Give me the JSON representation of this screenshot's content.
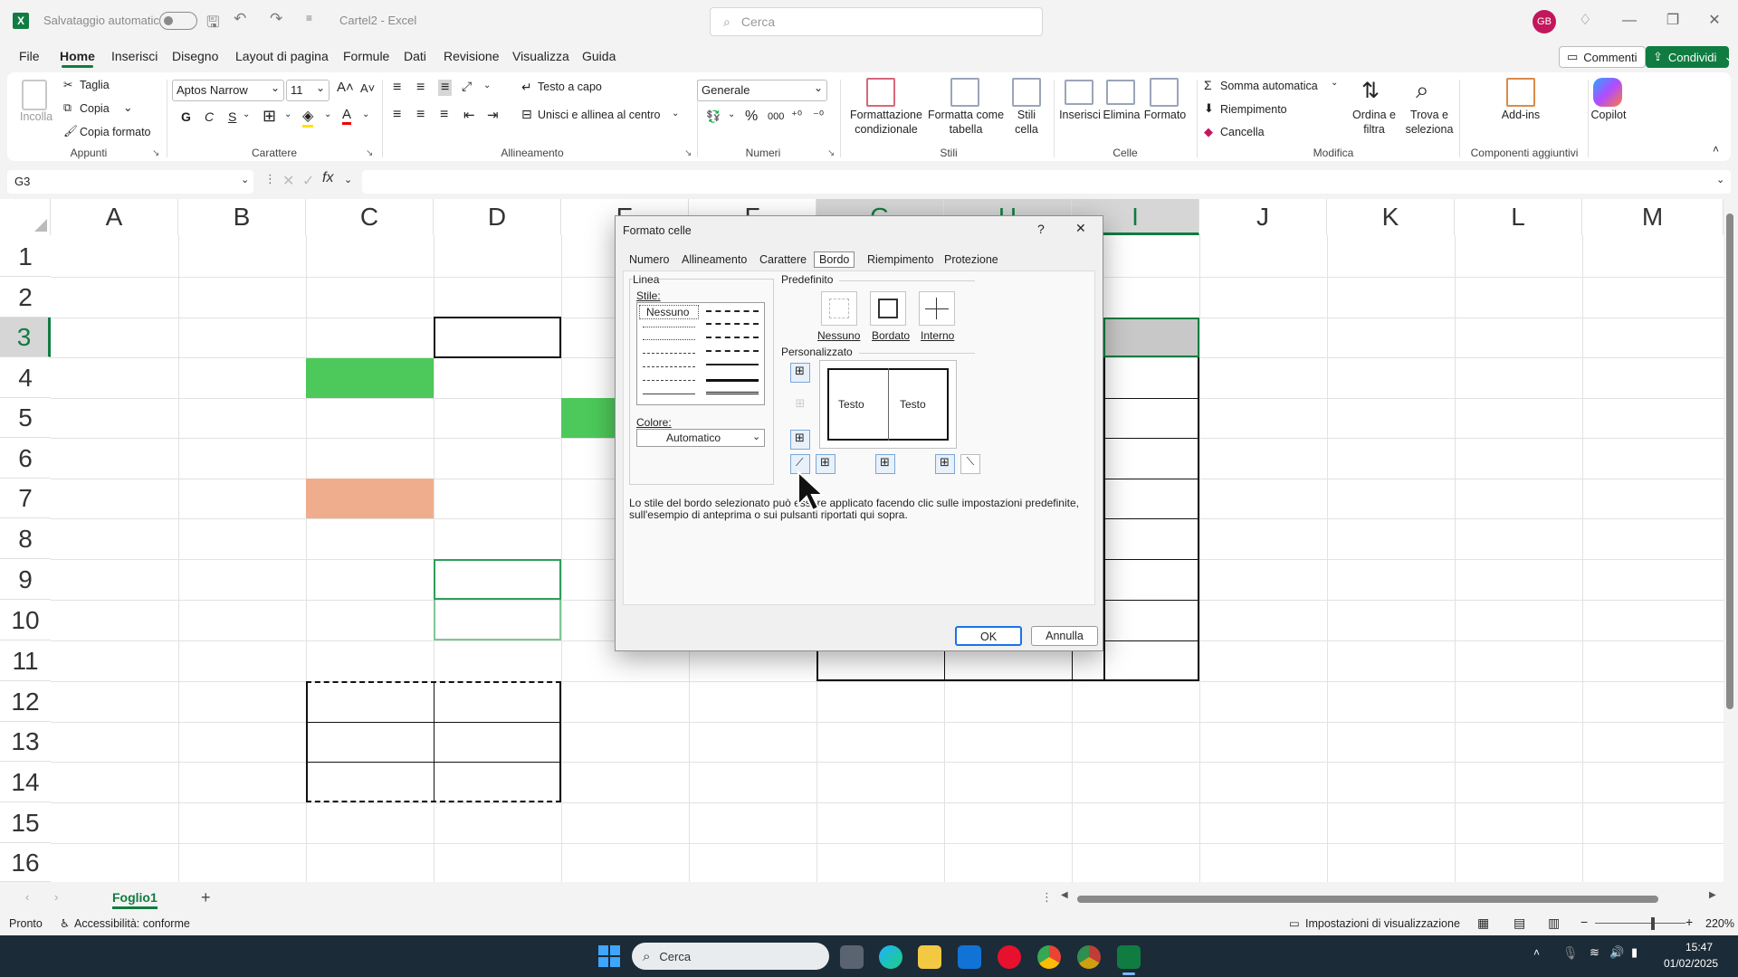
{
  "titlebar": {
    "autosave_label": "Salvataggio automatico",
    "doc_title": "Cartel2  -  Excel",
    "search_placeholder": "Cerca",
    "avatar_initials": "GB"
  },
  "menu": {
    "items": [
      "File",
      "Home",
      "Inserisci",
      "Disegno",
      "Layout di pagina",
      "Formule",
      "Dati",
      "Revisione",
      "Visualizza",
      "Guida"
    ],
    "active": "Home",
    "comments_label": "Commenti",
    "share_label": "Condividi"
  },
  "ribbon": {
    "clipboard": {
      "paste": "Incolla",
      "cut": "Taglia",
      "copy": "Copia",
      "format_painter": "Copia formato",
      "group": "Appunti"
    },
    "font": {
      "name": "Aptos Narrow",
      "size": "11",
      "bold": "G",
      "italic": "C",
      "underline": "S",
      "group": "Carattere"
    },
    "alignment": {
      "wrap": "Testo a capo",
      "merge": "Unisci e allinea al centro",
      "group": "Allineamento"
    },
    "number": {
      "format": "Generale",
      "group": "Numeri",
      "percent": "%",
      "thousands": "000"
    },
    "styles": {
      "conditional": [
        "Formattazione",
        "condizionale"
      ],
      "table": [
        "Formatta come",
        "tabella"
      ],
      "cell_styles": [
        "Stili",
        "cella"
      ],
      "group": "Stili"
    },
    "cells": {
      "insert": "Inserisci",
      "delete": "Elimina",
      "format": "Formato",
      "group": "Celle"
    },
    "editing": {
      "autosum": "Somma automatica",
      "fill": "Riempimento",
      "clear": "Cancella",
      "sort": [
        "Ordina e",
        "filtra"
      ],
      "find": [
        "Trova e",
        "seleziona"
      ],
      "group": "Modifica"
    },
    "addins": {
      "addins": "Add-ins",
      "group": "Componenti aggiuntivi"
    },
    "copilot": "Copilot"
  },
  "formula_bar": {
    "name_box": "G3",
    "fx": "fx",
    "content": ""
  },
  "grid": {
    "columns": [
      "A",
      "B",
      "C",
      "D",
      "E",
      "F",
      "G",
      "H",
      "I",
      "J",
      "K",
      "L",
      "M"
    ],
    "rows": [
      "1",
      "2",
      "3",
      "4",
      "5",
      "6",
      "7",
      "8",
      "9",
      "10",
      "11",
      "12",
      "13",
      "14",
      "15",
      "16"
    ],
    "selected_columns": [
      "G",
      "H",
      "I"
    ],
    "selected_row": "3",
    "colors": {
      "green": "#4cc95a",
      "salmon": "#f0ad8e",
      "selection": "#c8c8c8",
      "accent": "#107c41"
    }
  },
  "sheet": {
    "tab": "Foglio1",
    "add": "+"
  },
  "status": {
    "ready": "Pronto",
    "accessibility": "Accessibilità: conforme",
    "view_settings": "Impostazioni di visualizzazione",
    "zoom": "220%"
  },
  "taskbar": {
    "search": "Cerca",
    "time": "15:47",
    "date": "01/02/2025"
  },
  "dialog": {
    "title": "Formato celle",
    "help": "?",
    "close": "✕",
    "tabs": [
      "Numero",
      "Allineamento",
      "Carattere",
      "Bordo",
      "Riempimento",
      "Protezione"
    ],
    "active_tab": "Bordo",
    "line_label": "Linea",
    "style_label": "Stile:",
    "style_none": "Nessuno",
    "color_label": "Colore:",
    "color_value": "Automatico",
    "presets_label": "Predefinito",
    "presets": [
      "Nessuno",
      "Bordato",
      "Interno"
    ],
    "custom_label": "Personalizzato",
    "preview_text": [
      "Testo",
      "Testo"
    ],
    "help_text": "Lo stile del bordo selezionato può essere applicato facendo clic sulle impostazioni predefinite, sull'esempio di anteprima o sui pulsanti riportati qui sopra.",
    "ok": "OK",
    "cancel": "Annulla"
  }
}
